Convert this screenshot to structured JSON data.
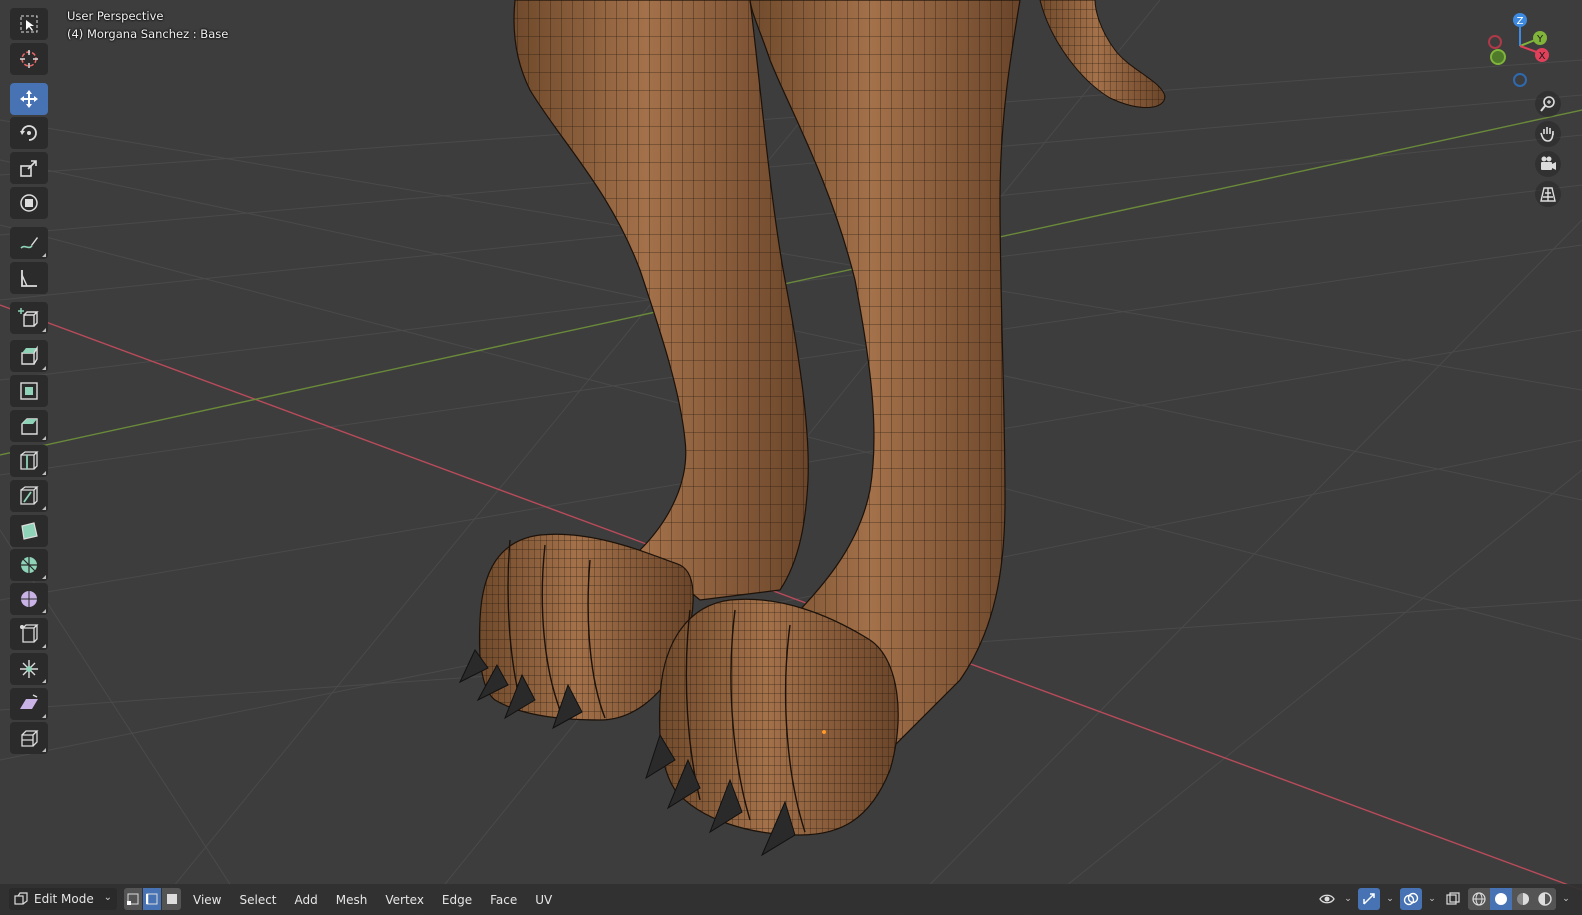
{
  "viewport": {
    "title": "User Perspective",
    "subtitle": "(4) Morgana Sanchez : Base"
  },
  "toolbar": {
    "tools": [
      {
        "name": "select-box-tool",
        "icon": "select-box-icon",
        "active": false
      },
      {
        "name": "cursor-tool",
        "icon": "cursor-icon",
        "active": false
      },
      {
        "name": "move-tool",
        "icon": "move-icon",
        "active": true
      },
      {
        "name": "rotate-tool",
        "icon": "rotate-icon",
        "active": false
      },
      {
        "name": "scale-tool",
        "icon": "scale-icon",
        "active": false
      },
      {
        "name": "transform-tool",
        "icon": "transform-icon",
        "active": false
      },
      {
        "name": "annotate-tool",
        "icon": "annotate-icon",
        "active": false
      },
      {
        "name": "measure-tool",
        "icon": "measure-icon",
        "active": false
      },
      {
        "name": "add-cube-tool",
        "icon": "add-cube-icon",
        "active": false
      },
      {
        "name": "extrude-tool",
        "icon": "extrude-icon",
        "active": false
      },
      {
        "name": "inset-faces-tool",
        "icon": "inset-icon",
        "active": false
      },
      {
        "name": "bevel-tool",
        "icon": "bevel-icon",
        "active": false
      },
      {
        "name": "loop-cut-tool",
        "icon": "loop-cut-icon",
        "active": false
      },
      {
        "name": "knife-tool",
        "icon": "knife-icon",
        "active": false
      },
      {
        "name": "poly-build-tool",
        "icon": "poly-build-icon",
        "active": false
      },
      {
        "name": "spin-tool",
        "icon": "spin-icon",
        "active": false
      },
      {
        "name": "smooth-tool",
        "icon": "smooth-icon",
        "active": false
      },
      {
        "name": "edge-slide-tool",
        "icon": "edge-slide-icon",
        "active": false
      },
      {
        "name": "shrink-fatten-tool",
        "icon": "shrink-fatten-icon",
        "active": false
      },
      {
        "name": "shear-tool",
        "icon": "shear-icon",
        "active": false
      },
      {
        "name": "rip-region-tool",
        "icon": "rip-region-icon",
        "active": false
      }
    ]
  },
  "gizmo": {
    "axes": {
      "x": "X",
      "y": "Y",
      "z": "Z"
    },
    "colors": {
      "x": "#e0405a",
      "y": "#80b43a",
      "z": "#3d8ae0"
    }
  },
  "nav_buttons": [
    "zoom-icon",
    "hand-icon",
    "camera-icon",
    "grid-view-icon"
  ],
  "footer": {
    "mode": "Edit Mode",
    "menus": [
      "View",
      "Select",
      "Add",
      "Mesh",
      "Vertex",
      "Edge",
      "Face",
      "UV"
    ],
    "select_modes": [
      "vertex-select-icon",
      "edge-select-icon",
      "face-select-icon"
    ],
    "active_select_mode": "edge-select-icon"
  },
  "colors": {
    "accent": "#4772b3",
    "background": "#3d3d3d",
    "skin": "#93643f",
    "x_axis_line": "#b84b5a",
    "y_axis_line": "#6a8a3a"
  }
}
